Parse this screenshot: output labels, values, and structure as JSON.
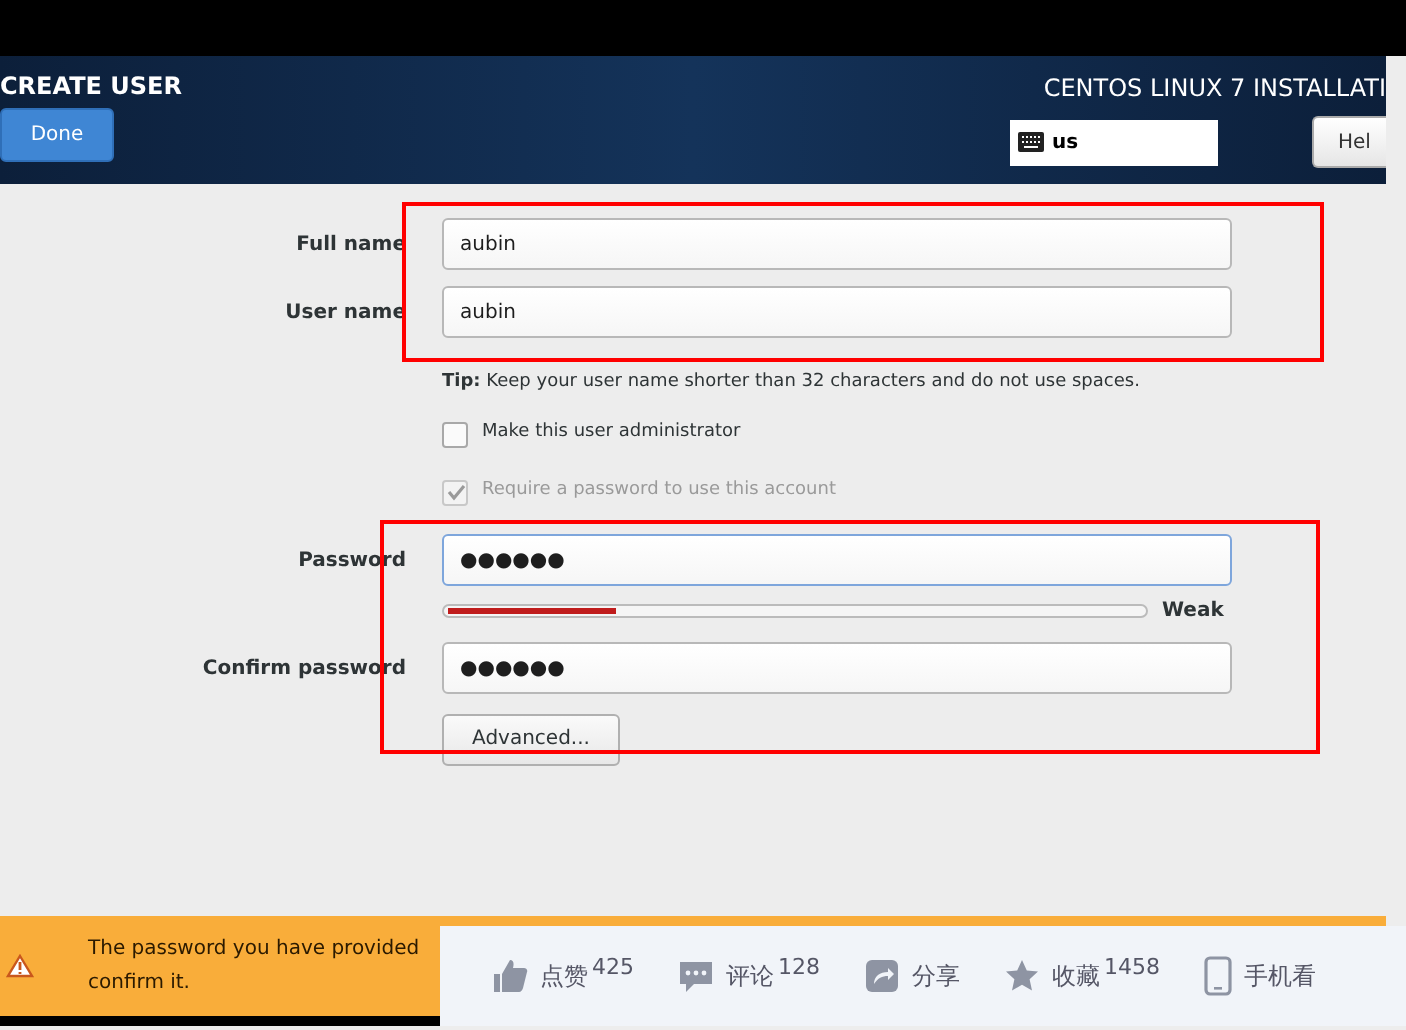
{
  "header": {
    "title": "CREATE USER",
    "done_button": "Done",
    "product": "CENTOS LINUX 7 INSTALLATI",
    "keyboard_layout": "us",
    "help_button": "Hel"
  },
  "fields": [
    {
      "label": "Full name",
      "value": "aubin",
      "kind": "text",
      "focused": false
    },
    {
      "label": "User name",
      "value": "aubin",
      "kind": "text",
      "focused": false
    },
    {
      "kind": "tip",
      "bold": "Tip:",
      "text": "Keep your user name shorter than 32 characters and do not use spaces."
    },
    {
      "kind": "checkbox",
      "label": "Make this user administrator",
      "checked": false,
      "disabled": false
    },
    {
      "kind": "checkbox",
      "label": "Require a password to use this account",
      "checked": true,
      "disabled": true
    },
    {
      "label": "Password",
      "value": "●●●●●●",
      "kind": "text",
      "focused": true
    },
    {
      "kind": "meter",
      "level": 0.24,
      "reading": "Weak"
    },
    {
      "label": "Confirm password",
      "value": "●●●●●●",
      "kind": "text",
      "focused": false
    },
    {
      "kind": "button",
      "label": "Advanced..."
    }
  ],
  "warning": {
    "lines": [
      "The password you have provided",
      "confirm it."
    ]
  },
  "toolbar": [
    {
      "label": "点赞",
      "count": "425",
      "kind": "like"
    },
    {
      "label": "评论",
      "count": "128",
      "kind": "comment"
    },
    {
      "label": "分享",
      "kind": "share"
    },
    {
      "label": "收藏",
      "count": "1458",
      "kind": "star"
    },
    {
      "label": "手机看",
      "kind": "phone"
    }
  ]
}
